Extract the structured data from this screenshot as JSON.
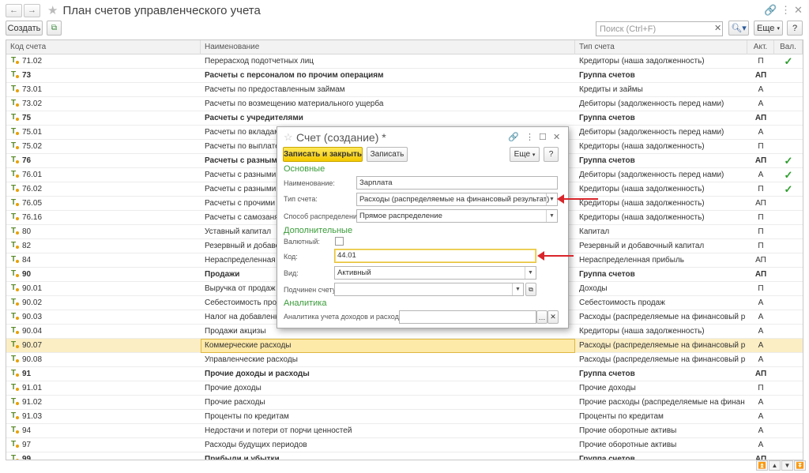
{
  "window": {
    "title": "План счетов управленческого учета"
  },
  "toolbar": {
    "create_label": "Создать",
    "search_placeholder": "Поиск (Ctrl+F)",
    "more_label": "Еще",
    "help_label": "?"
  },
  "table": {
    "columns": [
      "Код счета",
      "Наименование",
      "Тип счета",
      "Акт.",
      "Вал."
    ],
    "rows": [
      {
        "code": "71.02",
        "name": "Перерасход подотчетных лиц",
        "type": "Кредиторы (наша задолженность)",
        "act": "П",
        "cur": "✓",
        "bold": false
      },
      {
        "code": "73",
        "name": "Расчеты с персоналом по прочим операциям",
        "type": "Группа счетов",
        "act": "АП",
        "cur": "",
        "bold": true
      },
      {
        "code": "73.01",
        "name": "Расчеты по предоставленным займам",
        "type": "Кредиты и займы",
        "act": "А",
        "cur": "",
        "bold": false
      },
      {
        "code": "73.02",
        "name": "Расчеты по возмещению материального ущерба",
        "type": "Дебиторы (задолженность перед нами)",
        "act": "А",
        "cur": "",
        "bold": false
      },
      {
        "code": "75",
        "name": "Расчеты с учредителями",
        "type": "Группа счетов",
        "act": "АП",
        "cur": "",
        "bold": true
      },
      {
        "code": "75.01",
        "name": "Расчеты по вкладам в ус",
        "type": "Дебиторы (задолженность перед нами)",
        "act": "А",
        "cur": "",
        "bold": false
      },
      {
        "code": "75.02",
        "name": "Расчеты по выплате дох",
        "type": "Кредиторы (наша задолженность)",
        "act": "П",
        "cur": "",
        "bold": false
      },
      {
        "code": "76",
        "name": "Расчеты с разными де",
        "type": "Группа счетов",
        "act": "АП",
        "cur": "✓",
        "bold": true
      },
      {
        "code": "76.01",
        "name": "Расчеты с разными деби",
        "type": "Дебиторы (задолженность перед нами)",
        "act": "А",
        "cur": "✓",
        "bold": false
      },
      {
        "code": "76.02",
        "name": "Расчеты с разными кред",
        "type": "Кредиторы (наша задолженность)",
        "act": "П",
        "cur": "✓",
        "bold": false
      },
      {
        "code": "76.05",
        "name": "Расчеты с прочими поста",
        "type": "Кредиторы (наша задолженность)",
        "act": "АП",
        "cur": "",
        "bold": false
      },
      {
        "code": "76.16",
        "name": "Расчеты с самозанятыми",
        "type": "Кредиторы (наша задолженность)",
        "act": "П",
        "cur": "",
        "bold": false
      },
      {
        "code": "80",
        "name": "Уставный капитал",
        "type": "Капитал",
        "act": "П",
        "cur": "",
        "bold": false
      },
      {
        "code": "82",
        "name": "Резервный и добавочный",
        "type": "Резервный и добавочный капитал",
        "act": "П",
        "cur": "",
        "bold": false
      },
      {
        "code": "84",
        "name": "Нераспределенная прибы",
        "type": "Нераспределенная прибыль",
        "act": "АП",
        "cur": "",
        "bold": false
      },
      {
        "code": "90",
        "name": "Продажи",
        "type": "Группа счетов",
        "act": "АП",
        "cur": "",
        "bold": true
      },
      {
        "code": "90.01",
        "name": "Выручка от продаж",
        "type": "Доходы",
        "act": "П",
        "cur": "",
        "bold": false
      },
      {
        "code": "90.02",
        "name": "Себестоимость продаж",
        "type": "Себестоимость продаж",
        "act": "А",
        "cur": "",
        "bold": false
      },
      {
        "code": "90.03",
        "name": "Налог на добавленную ст",
        "type": "Расходы (распределяемые на финансовый результат)",
        "act": "А",
        "cur": "",
        "bold": false
      },
      {
        "code": "90.04",
        "name": "Продажи акцизы",
        "type": "Кредиторы (наша задолженность)",
        "act": "А",
        "cur": "",
        "bold": false
      },
      {
        "code": "90.07",
        "name": "Коммерческие расходы",
        "type": "Расходы (распределяемые на финансовый результат)",
        "act": "А",
        "cur": "",
        "bold": false
      },
      {
        "code": "90.08",
        "name": "Управленческие расходы",
        "type": "Расходы (распределяемые на финансовый результат)",
        "act": "А",
        "cur": "",
        "bold": false
      },
      {
        "code": "91",
        "name": "Прочие доходы и расходы",
        "type": "Группа счетов",
        "act": "АП",
        "cur": "",
        "bold": true
      },
      {
        "code": "91.01",
        "name": "Прочие доходы",
        "type": "Прочие доходы",
        "act": "П",
        "cur": "",
        "bold": false
      },
      {
        "code": "91.02",
        "name": "Прочие расходы",
        "type": "Прочие расходы (распределяемые на финансовый р...",
        "act": "А",
        "cur": "",
        "bold": false
      },
      {
        "code": "91.03",
        "name": "Проценты по кредитам",
        "type": "Проценты по кредитам",
        "act": "А",
        "cur": "",
        "bold": false
      },
      {
        "code": "94",
        "name": "Недостачи и потери от порчи ценностей",
        "type": "Прочие оборотные активы",
        "act": "А",
        "cur": "",
        "bold": false
      },
      {
        "code": "97",
        "name": "Расходы будущих периодов",
        "type": "Прочие оборотные активы",
        "act": "А",
        "cur": "",
        "bold": false
      },
      {
        "code": "99",
        "name": "Прибыли и убытки",
        "type": "Группа счетов",
        "act": "АП",
        "cur": "",
        "bold": true
      }
    ]
  },
  "dialog": {
    "title": "Счет (создание) *",
    "save_close_label": "Записать и закрыть",
    "save_label": "Записать",
    "more_label": "Еще",
    "help_label": "?",
    "group_main": "Основные",
    "name_label": "Наименование:",
    "name_value": "Зарплата",
    "type_label": "Тип счета:",
    "type_value": "Расходы (распределяемые на финансовый результат)",
    "distribution_label": "Способ распределения:",
    "distribution_value": "Прямое распределение",
    "group_additional": "Дополнительные",
    "currency_label": "Валютный:",
    "code_label": "Код:",
    "code_value": "44.01",
    "kind_label": "Вид:",
    "kind_value": "Активный",
    "parent_label": "Подчинен счету:",
    "parent_value": "",
    "group_analytics": "Аналитика",
    "analytics_label": "Аналитика учета доходов и расходов:",
    "analytics_value": ""
  },
  "colors": {
    "accent_yellow": "#f4c900",
    "group_green": "#3a9b3a",
    "arrow_red": "#d9262b",
    "selected_row": "#fbeec4"
  }
}
